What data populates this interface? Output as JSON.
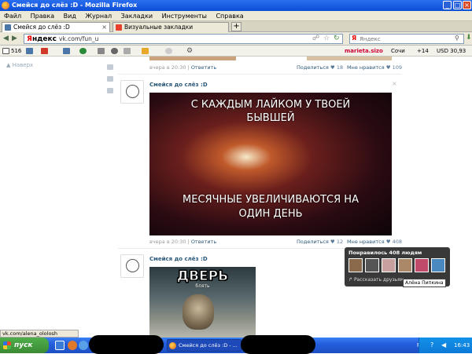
{
  "window": {
    "title": "Смейся до слёз :D - Mozilla Firefox",
    "controls": [
      "_",
      "□",
      "×"
    ]
  },
  "menu": [
    "Файл",
    "Правка",
    "Вид",
    "Журнал",
    "Закладки",
    "Инструменты",
    "Справка"
  ],
  "tabs": [
    {
      "label": "Смейся до слёз :D",
      "active": true
    },
    {
      "label": "Визуальные закладки",
      "active": false
    }
  ],
  "newtab_label": "+",
  "nav": {
    "yandex_logo_red": "Я",
    "yandex_logo_rest": "ндекс",
    "url": "vk.com/fun_u",
    "search_placeholder": "Яндекс"
  },
  "toolbar2": {
    "mail_count": "516",
    "user": "marieta.sizo",
    "city": "Сочи",
    "weather": "+14",
    "currency": "USD 30,93"
  },
  "vk": {
    "navup": "Наверх",
    "post_top": {
      "time": "вчера в 20:30",
      "reply": "Ответить",
      "share": "Поделиться",
      "share_count": "18",
      "like": "Мне нравится",
      "like_count": "109"
    },
    "post1": {
      "author": "Смейся до слёз :D",
      "image_line1": "С КАЖДЫМ ЛАЙКОМ У ТВОЕЙ",
      "image_line2": "БЫВШЕЙ",
      "image_line3": "МЕСЯЧНЫЕ УВЕЛИЧИВАЮТСЯ НА",
      "image_line4": "ОДИН ДЕНЬ",
      "time": "вчера в 20:30",
      "reply": "Ответить",
      "share": "Поделиться",
      "share_count": "12",
      "like": "Мне нравится",
      "like_count": "408"
    },
    "post2": {
      "author": "Смейся до слёз :D",
      "image_title": "ДВЕРЬ",
      "image_sub": "блять"
    },
    "popup": {
      "title": "Понравилось 408 людям",
      "share": "Рассказать друзьям",
      "tooltip": "Алёна Пипкина"
    }
  },
  "status_url": "vk.com/alena_ololosh",
  "taskbar": {
    "start": "пуск",
    "item": "Смейся до слёз :D - ...",
    "lang": "RU",
    "clock": "16:43"
  }
}
